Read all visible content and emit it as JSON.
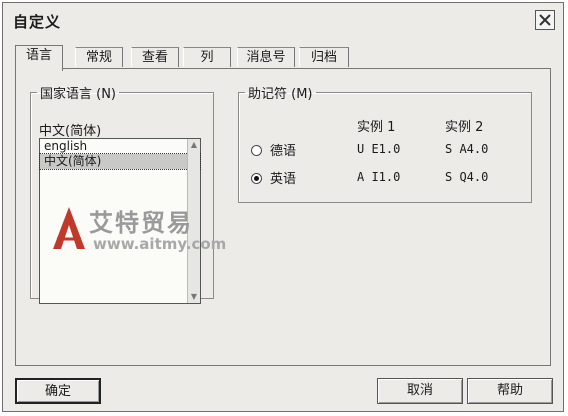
{
  "window": {
    "title": "自定义"
  },
  "tabs": [
    {
      "label": "语言",
      "active": true
    },
    {
      "label": "常规",
      "active": false
    },
    {
      "label": "查看",
      "active": false
    },
    {
      "label": "列",
      "active": false
    },
    {
      "label": "消息号",
      "active": false
    },
    {
      "label": "归档",
      "active": false
    }
  ],
  "language_group": {
    "legend": "国家语言 (N)",
    "current": "中文(简体)",
    "options": [
      "english",
      "中文(简体)"
    ],
    "selected": "中文(简体)"
  },
  "mnemonic_group": {
    "legend": "助记符 (M)",
    "columns": [
      "实例 1",
      "实例 2"
    ],
    "rows": [
      {
        "label": "德语",
        "selected": false,
        "example1": "U E1.0",
        "example2": "S A4.0"
      },
      {
        "label": "英语",
        "selected": true,
        "example1": "A I1.0",
        "example2": "S Q4.0"
      }
    ]
  },
  "watermark": {
    "text": "艾特贸易",
    "url": "www.aitmy.com",
    "color": "#c0392b"
  },
  "buttons": {
    "ok": "确定",
    "cancel": "取消",
    "help": "帮助"
  }
}
